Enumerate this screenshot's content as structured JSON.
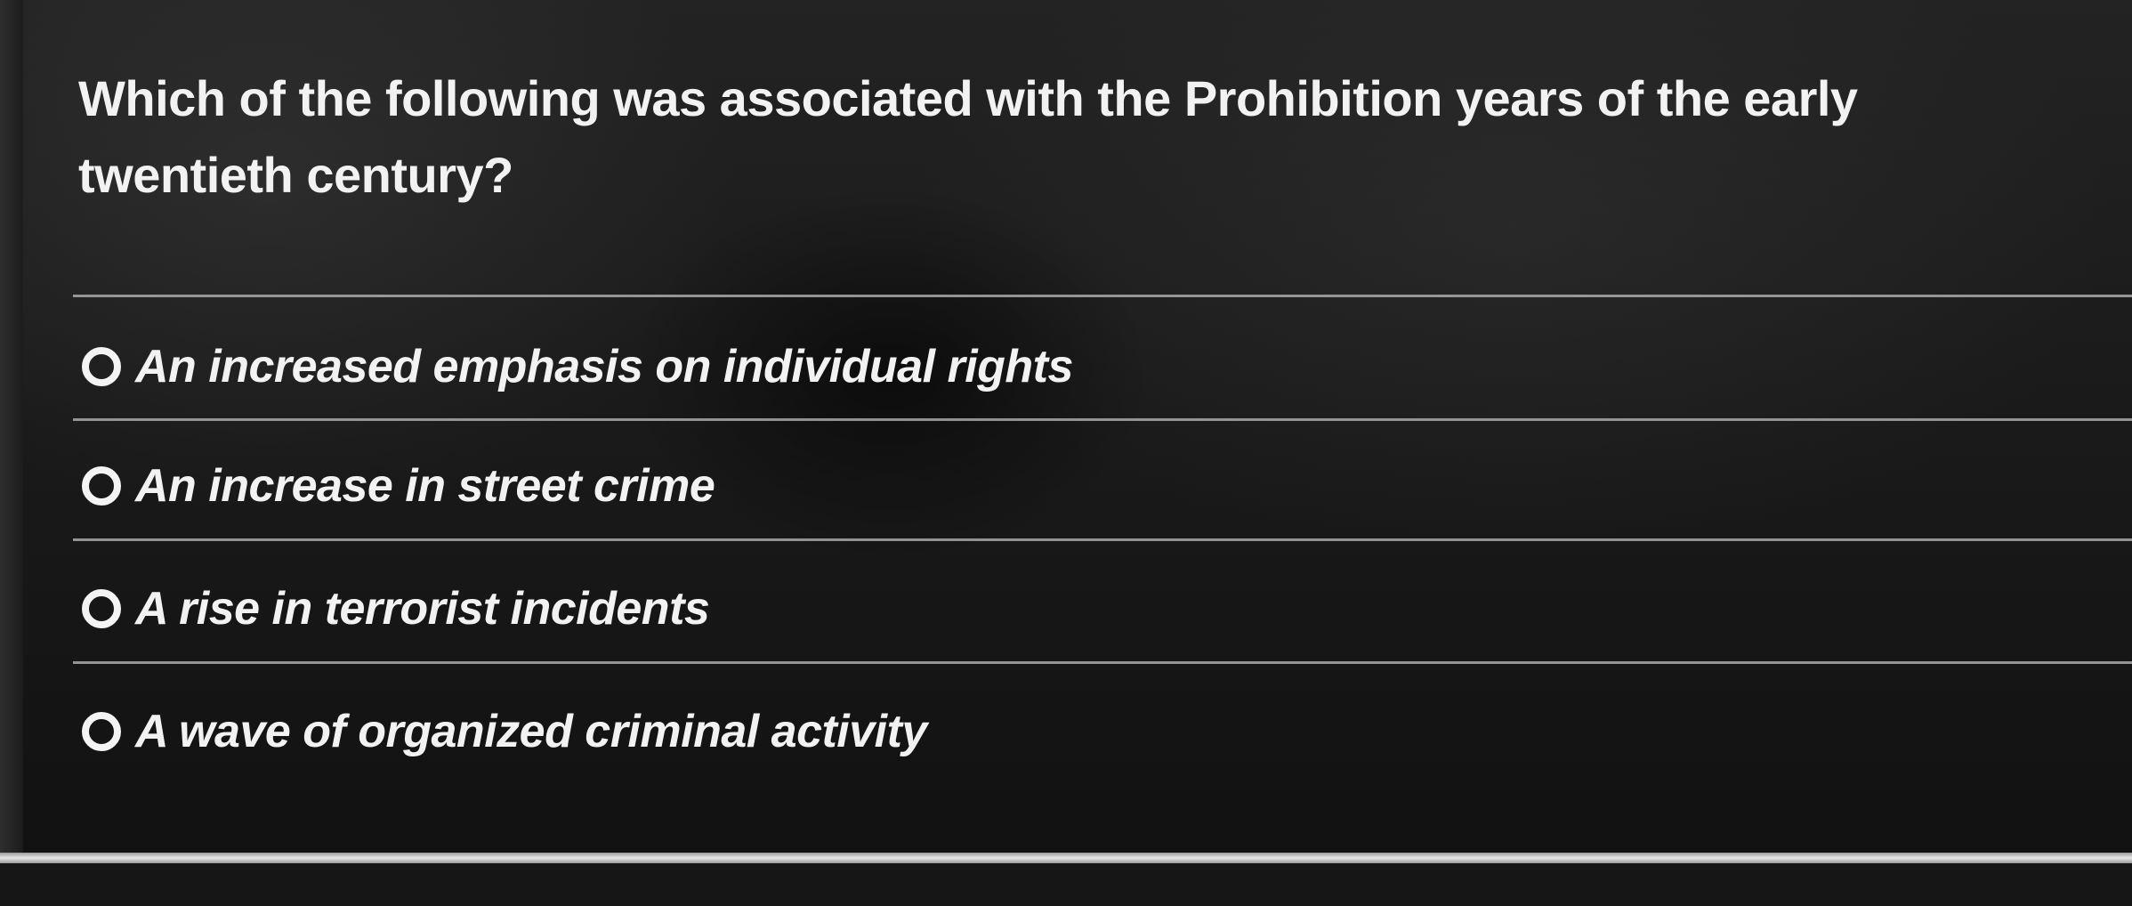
{
  "question": {
    "text": "Which of the following was associated with the Prohibition years of the early twentieth century?"
  },
  "options": [
    {
      "label": "An increased emphasis on individual rights",
      "selected": false
    },
    {
      "label": "An increase in street crime",
      "selected": false
    },
    {
      "label": "A rise in terrorist incidents",
      "selected": false
    },
    {
      "label": "A wave of organized criminal activity",
      "selected": false
    }
  ],
  "colors": {
    "text": "#f2f2f2",
    "background": "#1b1b1b",
    "divider": "#bdbdbd"
  }
}
